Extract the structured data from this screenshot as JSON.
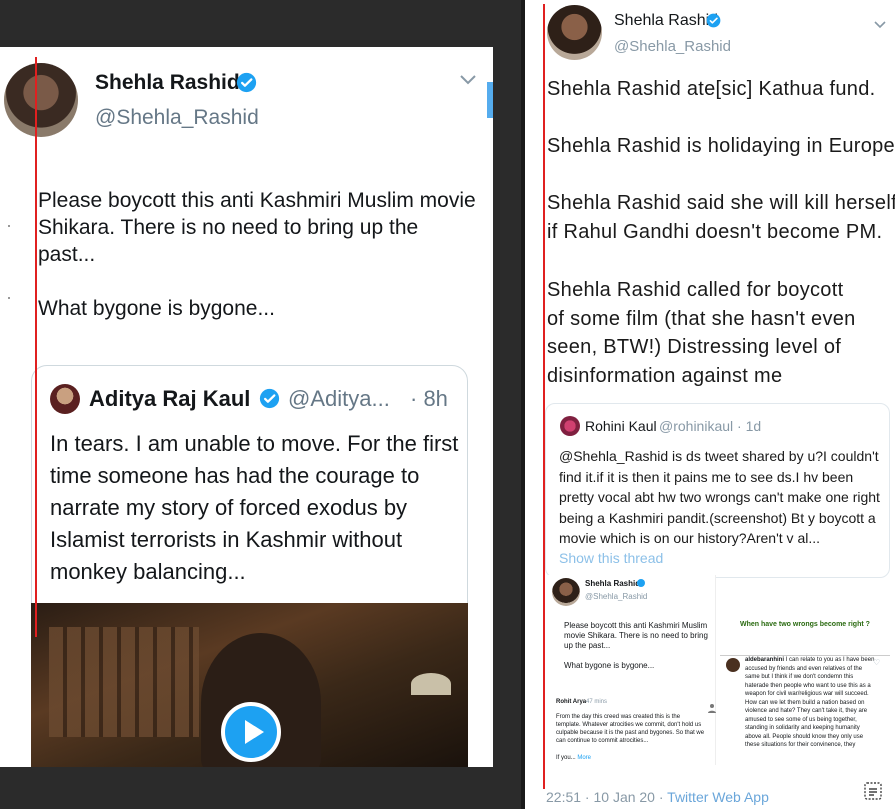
{
  "left_tweet": {
    "author_name": "Shehla Rashid",
    "author_handle": "@Shehla_Rashid",
    "text": "Please boycott this anti Kashmiri Muslim movie Shikara. There is no need to bring up the past...\n\nWhat bygone is bygone...",
    "quoted": {
      "author_name": "Aditya Raj Kaul",
      "author_handle": "@Aditya...",
      "time": "· 8h",
      "text": "In tears. I am unable to move. For the first time someone has had the courage to narrate my story of forced exodus by Islamist terrorists in Kashmir without monkey balancing..."
    }
  },
  "right_tweet": {
    "author_name": "Shehla Rashid",
    "author_handle": "@Shehla_Rashid",
    "lines": [
      "Shehla Rashid ate[sic] Kathua fund.",
      "Shehla Rashid is holidaying in Europe.",
      "Shehla Rashid said she will kill herself",
      "if Rahul Gandhi doesn't become PM.",
      "Shehla Rashid called for boycott",
      "of some film (that she hasn't even",
      "seen, BTW!) Distressing level of",
      "disinformation against me"
    ],
    "quoted": {
      "author_name": "Rohini Kaul",
      "author_handle": "@rohinikaul · 1d",
      "text": "@Shehla_Rashid is ds tweet shared by u?I couldn't find it.if it is then it pains me to see ds.I hv been pretty vocal abt hw two wrongs can't make one right being a Kashmiri pandit.(screenshot) Bt y boycott a movie which is on our history?Aren't v al...",
      "show_thread": "Show this thread"
    },
    "screenshot_a": {
      "author_name": "Shehla Rashid",
      "author_handle": "@Shehla_Rashid",
      "text": "Please boycott this anti Kashmiri Muslim movie Shikara. There is no need to bring up the past...\n\nWhat bygone is bygone...",
      "reply_name": "Rohit Arya",
      "reply_time": "47 mins",
      "reply_text": "From the day this creed was created this is the template. Whatever atrocities we commit, don't hold us culpable because it is the past and bygones. So that we can continue to commit atrocities...",
      "reply_more_prefix": "If you... ",
      "reply_more": "More"
    },
    "screenshot_b": {
      "title": "When have two wrongs become right ?"
    },
    "screenshot_c": {
      "name": "aldebaranhini",
      "text": " I can relate to you as I have been accused by friends and even relatives of the same but I think if we don't condemn this haterade then people who want to use this as a weapon for civil war/religious war will succeed. How can we let them build a nation based on violence and hate? They can't take it, they are amused to see some of us being together, standing in solidarity and keeping humanity above all. People should know they only use these situations for their convinence, they"
    },
    "footer": {
      "time": "22:51 · 10 Jan 20 · ",
      "app": "Twitter Web App"
    }
  },
  "colors": {
    "verified_blue": "#1da1f2",
    "red_line": "#e02020",
    "link_blue": "#6aa6da"
  }
}
